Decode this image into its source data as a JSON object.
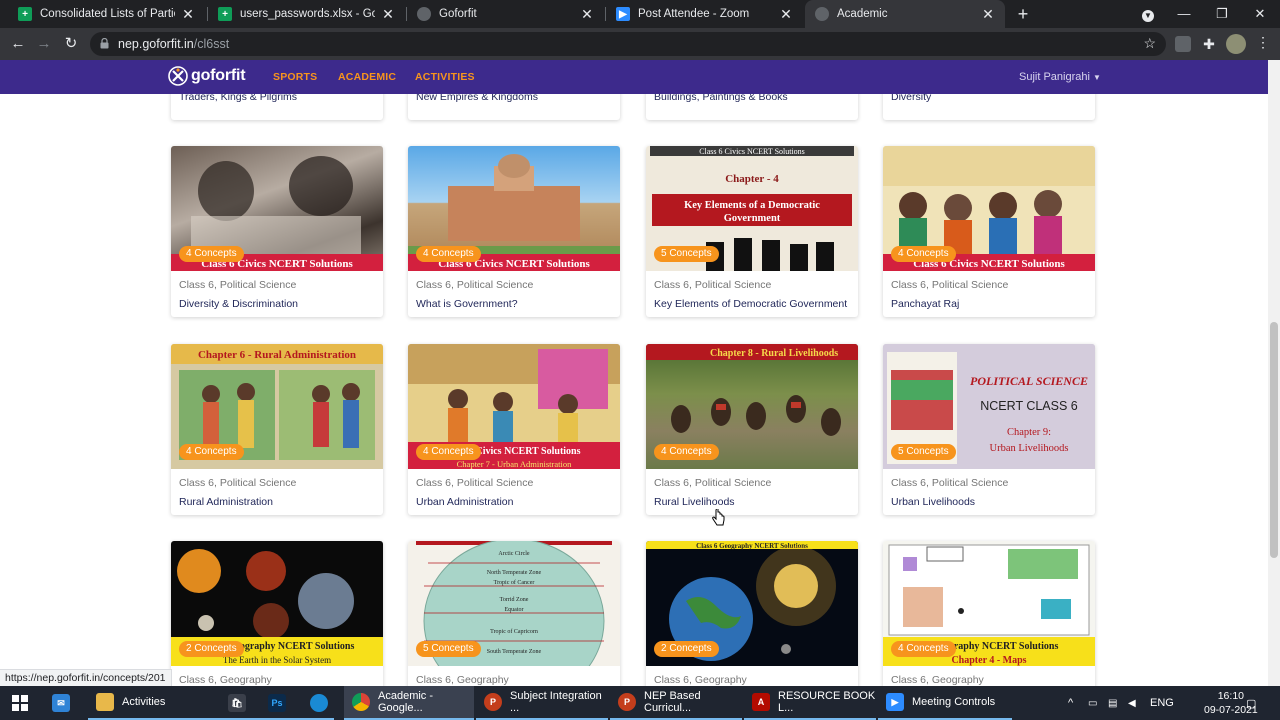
{
  "browser": {
    "tabs": [
      {
        "title": "Consolidated Lists of Participants",
        "icon": "sheets-icon",
        "active": false
      },
      {
        "title": "users_passwords.xlsx - Google Sh",
        "icon": "sheets-icon",
        "active": false
      },
      {
        "title": "Goforfit",
        "icon": "globe-icon",
        "active": false
      },
      {
        "title": "Post Attendee - Zoom",
        "icon": "zoom-icon",
        "active": false
      },
      {
        "title": "Academic",
        "icon": "globe-icon",
        "active": true
      }
    ],
    "url_host": "nep.goforfit.in",
    "url_path": "/cl6sst",
    "status_link": "https://nep.goforfit.in/concepts/201"
  },
  "site": {
    "logo_text": "goforfit",
    "nav": [
      "SPORTS",
      "ACADEMIC",
      "ACTIVITIES"
    ],
    "user": "Sujit Panigrahi"
  },
  "top_row": [
    "Traders, Kings & Pilgrims",
    "New Empires & Kingdoms",
    "Buildings, Paintings & Books",
    "Diversity"
  ],
  "cards": [
    {
      "badge": "4 Concepts",
      "meta": "Class 6, Political Science",
      "title": "Diversity & Discrimination",
      "thumb_text": [
        "Class 6 Civics NCERT Solutions"
      ]
    },
    {
      "badge": "4 Concepts",
      "meta": "Class 6, Political Science",
      "title": "What is Government?",
      "thumb_text": [
        "Class 6 Civics NCERT Solutions"
      ]
    },
    {
      "badge": "5 Concepts",
      "meta": "Class 6, Political Science",
      "title": "Key Elements of Democratic Government",
      "thumb_text": [
        "Class 6 Civics NCERT Solutions",
        "Chapter - 4",
        "Key Elements of a Democratic Government"
      ]
    },
    {
      "badge": "4 Concepts",
      "meta": "Class 6, Political Science",
      "title": "Panchayat Raj",
      "thumb_text": [
        "Class 6 Civics NCERT Solutions"
      ]
    },
    {
      "badge": "4 Concepts",
      "meta": "Class 6, Political Science",
      "title": "Rural Administration",
      "thumb_text": [
        "Chapter 6 - Rural Administration"
      ]
    },
    {
      "badge": "4 Concepts",
      "meta": "Class 6, Political Science",
      "title": "Urban Administration",
      "thumb_text": [
        "Civics NCERT Solutions",
        "Chapter 7 - Urban Administration"
      ]
    },
    {
      "badge": "4 Concepts",
      "meta": "Class 6, Political Science",
      "title": "Rural Livelihoods",
      "thumb_text": [
        "Chapter 8 - Rural Livelihoods"
      ]
    },
    {
      "badge": "5 Concepts",
      "meta": "Class 6, Political Science",
      "title": "Urban Livelihoods",
      "thumb_text": [
        "POLITICAL SCIENCE",
        "NCERT CLASS 6",
        "Chapter 9:",
        "Urban Livelihoods"
      ]
    },
    {
      "badge": "2 Concepts",
      "meta": "Class 6, Geography",
      "title": "",
      "thumb_text": [
        "Geography NCERT Solutions",
        "The Earth in the Solar System"
      ]
    },
    {
      "badge": "5 Concepts",
      "meta": "Class 6, Geography",
      "title": "",
      "thumb_text": [
        "Arctic Circle",
        "North Temperate Zone",
        "Tropic of Cancer",
        "Torrid Zone",
        "Equator",
        "Tropic of Capricorn",
        "South Temperate Zone"
      ]
    },
    {
      "badge": "2 Concepts",
      "meta": "Class 6, Geography",
      "title": "",
      "thumb_text": [
        "Class 6 Geography NCERT Solutions"
      ]
    },
    {
      "badge": "4 Concepts",
      "meta": "Class 6, Geography",
      "title": "",
      "thumb_text": [
        "Geography NCERT Solutions",
        "Chapter 4 - Maps"
      ]
    }
  ],
  "taskbar": {
    "items": [
      "Activities",
      "Academic - Google...",
      "Subject Integration ...",
      "NEP Based Curricul...",
      "RESOURCE BOOK L...",
      "Meeting Controls"
    ],
    "lang": "ENG",
    "time": "16:10",
    "date": "09-07-2021"
  },
  "colors": {
    "accent": "#f7941d",
    "nav_bg": "#3d2a8c",
    "title": "#22285a"
  }
}
